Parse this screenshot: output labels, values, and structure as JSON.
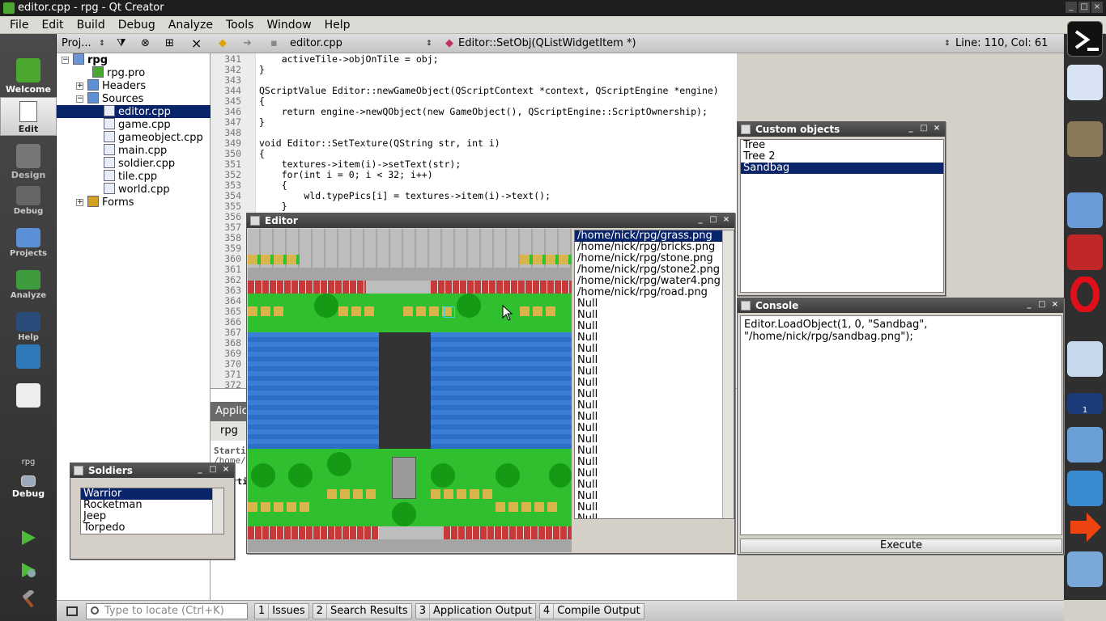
{
  "window": {
    "title": "editor.cpp - rpg - Qt Creator"
  },
  "menu": [
    "File",
    "Edit",
    "Build",
    "Debug",
    "Analyze",
    "Tools",
    "Window",
    "Help"
  ],
  "modes": {
    "welcome": "Welcome",
    "edit": "Edit",
    "design": "Design",
    "debug": "Debug",
    "projects": "Projects",
    "analyze": "Analyze",
    "help": "Help",
    "target_project": "rpg",
    "target_config": "Debug"
  },
  "project_panel": {
    "selector": "Proj...",
    "root": "rpg",
    "items": [
      "rpg.pro",
      "Headers",
      "Sources",
      "editor.cpp",
      "game.cpp",
      "gameobject.cpp",
      "main.cpp",
      "soldier.cpp",
      "tile.cpp",
      "world.cpp",
      "Forms"
    ]
  },
  "editor_toolbar": {
    "file": "editor.cpp",
    "function": "Editor::SetObj(QListWidgetItem *)",
    "position": "Line: 110, Col: 61"
  },
  "code": {
    "lines": [
      {
        "n": "341",
        "t": "    activeTile->objOnTile = obj;"
      },
      {
        "n": "342",
        "t": "}"
      },
      {
        "n": "343",
        "t": ""
      },
      {
        "n": "344",
        "t": "QScriptValue Editor::newGameObject(QScriptContext *context, QScriptEngine *engine)"
      },
      {
        "n": "345",
        "t": "{"
      },
      {
        "n": "346",
        "t": "    return engine->newQObject(new GameObject(), QScriptEngine::ScriptOwnership);"
      },
      {
        "n": "347",
        "t": "}"
      },
      {
        "n": "348",
        "t": ""
      },
      {
        "n": "349",
        "t": "void Editor::SetTexture(QString str, int i)"
      },
      {
        "n": "350",
        "t": "{"
      },
      {
        "n": "351",
        "t": "    textures->item(i)->setText(str);"
      },
      {
        "n": "352",
        "t": "    for(int i = 0; i < 32; i++)"
      },
      {
        "n": "353",
        "t": "    {"
      },
      {
        "n": "354",
        "t": "        wld.typePics[i] = textures->item(i)->text();"
      },
      {
        "n": "355",
        "t": "    }"
      },
      {
        "n": "356",
        "t": ""
      },
      {
        "n": "357",
        "t": ""
      },
      {
        "n": "358",
        "t": ""
      },
      {
        "n": "359",
        "t": ""
      },
      {
        "n": "360",
        "t": ""
      },
      {
        "n": "361",
        "t": ""
      },
      {
        "n": "362",
        "t": ""
      },
      {
        "n": "363",
        "t": ""
      },
      {
        "n": "364",
        "t": ""
      },
      {
        "n": "365",
        "t": ""
      },
      {
        "n": "366",
        "t": ""
      },
      {
        "n": "367",
        "t": ""
      },
      {
        "n": "368",
        "t": ""
      },
      {
        "n": "369",
        "t": ""
      },
      {
        "n": "370",
        "t": ""
      },
      {
        "n": "371",
        "t": ""
      },
      {
        "n": "372",
        "t": ""
      }
    ]
  },
  "output_pane": {
    "tab": "Applic",
    "run_tab": "rpg",
    "line1": "Starti",
    "line2": "/home/",
    "line3": "rti"
  },
  "editor_window": {
    "title": "Editor",
    "textures": [
      "/home/nick/rpg/grass.png",
      "/home/nick/rpg/bricks.png",
      "/home/nick/rpg/stone.png",
      "/home/nick/rpg/stone2.png",
      "/home/nick/rpg/water4.png",
      "/home/nick/rpg/road.png",
      "Null",
      "Null",
      "Null",
      "Null",
      "Null",
      "Null",
      "Null",
      "Null",
      "Null",
      "Null",
      "Null",
      "Null",
      "Null",
      "Null",
      "Null",
      "Null",
      "Null",
      "Null",
      "Null",
      "Null"
    ]
  },
  "custom_objects": {
    "title": "Custom objects",
    "items": [
      "Tree",
      "Tree 2",
      "Sandbag"
    ]
  },
  "console": {
    "title": "Console",
    "text1": "Editor.LoadObject(1, 0, \"Sandbag\",",
    "text2": "\"/home/nick/rpg/sandbag.png\");",
    "execute": "Execute"
  },
  "soldiers": {
    "title": "Soldiers",
    "items": [
      "Warrior",
      "Rocketman",
      "Jeep",
      "Torpedo"
    ]
  },
  "statusbar": {
    "locate_placeholder": "Type to locate (Ctrl+K)",
    "tabs": [
      {
        "num": "1",
        "label": "Issues"
      },
      {
        "num": "2",
        "label": "Search Results"
      },
      {
        "num": "3",
        "label": "Application Output"
      },
      {
        "num": "4",
        "label": "Compile Output"
      }
    ]
  },
  "dock": {
    "badge": "1"
  }
}
